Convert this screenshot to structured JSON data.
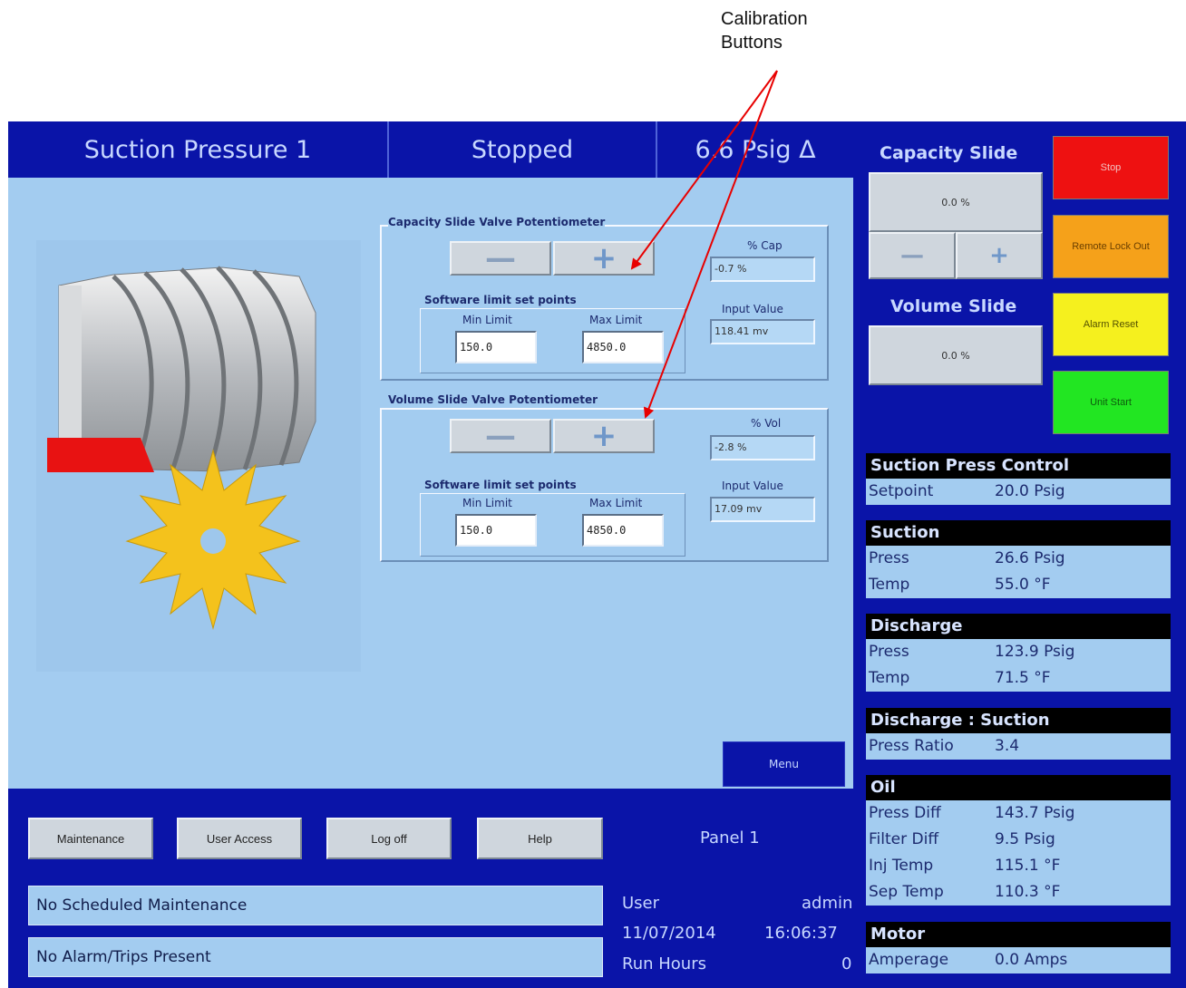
{
  "annotation": {
    "callout_line1": "Calibration",
    "callout_line2": "Buttons"
  },
  "header": {
    "title": "Suction Pressure 1",
    "state": "Stopped",
    "value": "6.6 Psig Δ"
  },
  "capacity_pot": {
    "title": "Capacity Slide Valve Potentiometer",
    "minus": "—",
    "plus": "+",
    "limits_title": "Software limit set points",
    "min_label": "Min Limit",
    "max_label": "Max Limit",
    "min_value": "150.0",
    "max_value": "4850.0",
    "pct_label": "% Cap",
    "pct_value": "-0.7 %",
    "input_label": "Input Value",
    "input_value": "118.41 mv"
  },
  "volume_pot": {
    "title": "Volume Slide Valve Potentiometer",
    "minus": "—",
    "plus": "+",
    "limits_title": "Software limit set points",
    "min_label": "Min Limit",
    "max_label": "Max Limit",
    "min_value": "150.0",
    "max_value": "4850.0",
    "pct_label": "% Vol",
    "pct_value": "-2.8 %",
    "input_label": "Input Value",
    "input_value": "17.09 mv"
  },
  "menu_label": "Menu",
  "bottom": {
    "buttons": [
      "Maintenance",
      "User Access",
      "Log off",
      "Help"
    ],
    "panel": "Panel 1",
    "maintenance_msg": "No Scheduled Maintenance",
    "alarm_msg": "No Alarm/Trips Present",
    "user_label": "User",
    "user_value": "admin",
    "date": "11/07/2014",
    "time": "16:06:37",
    "run_hours_label": "Run Hours",
    "run_hours_value": "0"
  },
  "right": {
    "capacity_slide": "Capacity Slide",
    "capacity_value": "0.0 %",
    "minus": "—",
    "plus": "+",
    "volume_slide": "Volume Slide",
    "volume_value": "0.0 %",
    "stop": "Stop",
    "remote_lock_out": "Remote Lock Out",
    "alarm_reset": "Alarm Reset",
    "unit_start": "Unit Start",
    "colors": {
      "stop": "#ee1111",
      "remote": "#f5a11a",
      "alarm": "#f5f01e",
      "start": "#22e622"
    }
  },
  "info": {
    "suction_control": {
      "header": "Suction Press Control",
      "setpoint_label": "Setpoint",
      "setpoint_value": "20.0 Psig"
    },
    "suction": {
      "header": "Suction",
      "press_label": "Press",
      "press_value": "26.6 Psig",
      "temp_label": "Temp",
      "temp_value": "55.0 °F"
    },
    "discharge": {
      "header": "Discharge",
      "press_label": "Press",
      "press_value": "123.9 Psig",
      "temp_label": "Temp",
      "temp_value": "71.5 °F"
    },
    "ratio": {
      "header": "Discharge : Suction",
      "label": "Press Ratio",
      "value": "3.4"
    },
    "oil": {
      "header": "Oil",
      "rows": [
        {
          "label": "Press Diff",
          "value": "143.7 Psig"
        },
        {
          "label": "Filter Diff",
          "value": "9.5 Psig"
        },
        {
          "label": "Inj Temp",
          "value": "115.1 °F"
        },
        {
          "label": "Sep Temp",
          "value": "110.3 °F"
        }
      ]
    },
    "motor": {
      "header": "Motor",
      "label": "Amperage",
      "value": "0.0 Amps"
    }
  }
}
